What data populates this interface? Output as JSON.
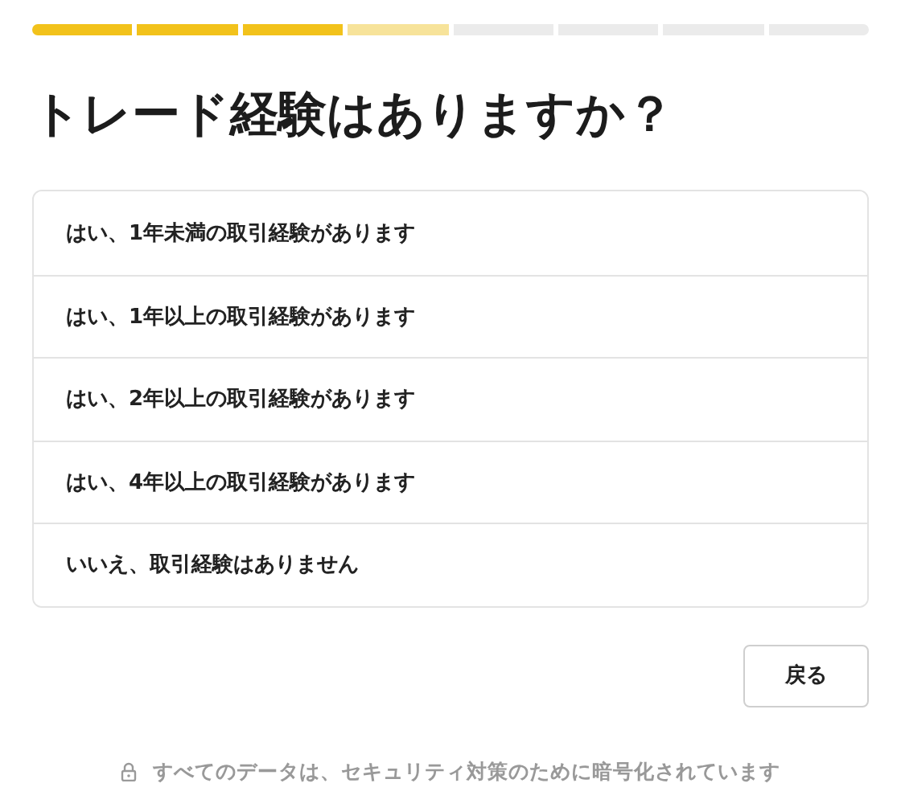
{
  "progress": {
    "steps": [
      {
        "completed": true,
        "current": false
      },
      {
        "completed": true,
        "current": false
      },
      {
        "completed": true,
        "current": false
      },
      {
        "completed": false,
        "current": true
      },
      {
        "completed": false,
        "current": false
      },
      {
        "completed": false,
        "current": false
      },
      {
        "completed": false,
        "current": false
      },
      {
        "completed": false,
        "current": false
      }
    ]
  },
  "title": "トレード経験はありますか？",
  "options": [
    {
      "label": "はい、1年未満の取引経験があります"
    },
    {
      "label": "はい、1年以上の取引経験があります"
    },
    {
      "label": "はい、2年以上の取引経験があります"
    },
    {
      "label": "はい、4年以上の取引経験があります"
    },
    {
      "label": "いいえ、取引経験はありません"
    }
  ],
  "back_button": "戻る",
  "security_note": "すべてのデータは、セキュリティ対策のために暗号化されています"
}
